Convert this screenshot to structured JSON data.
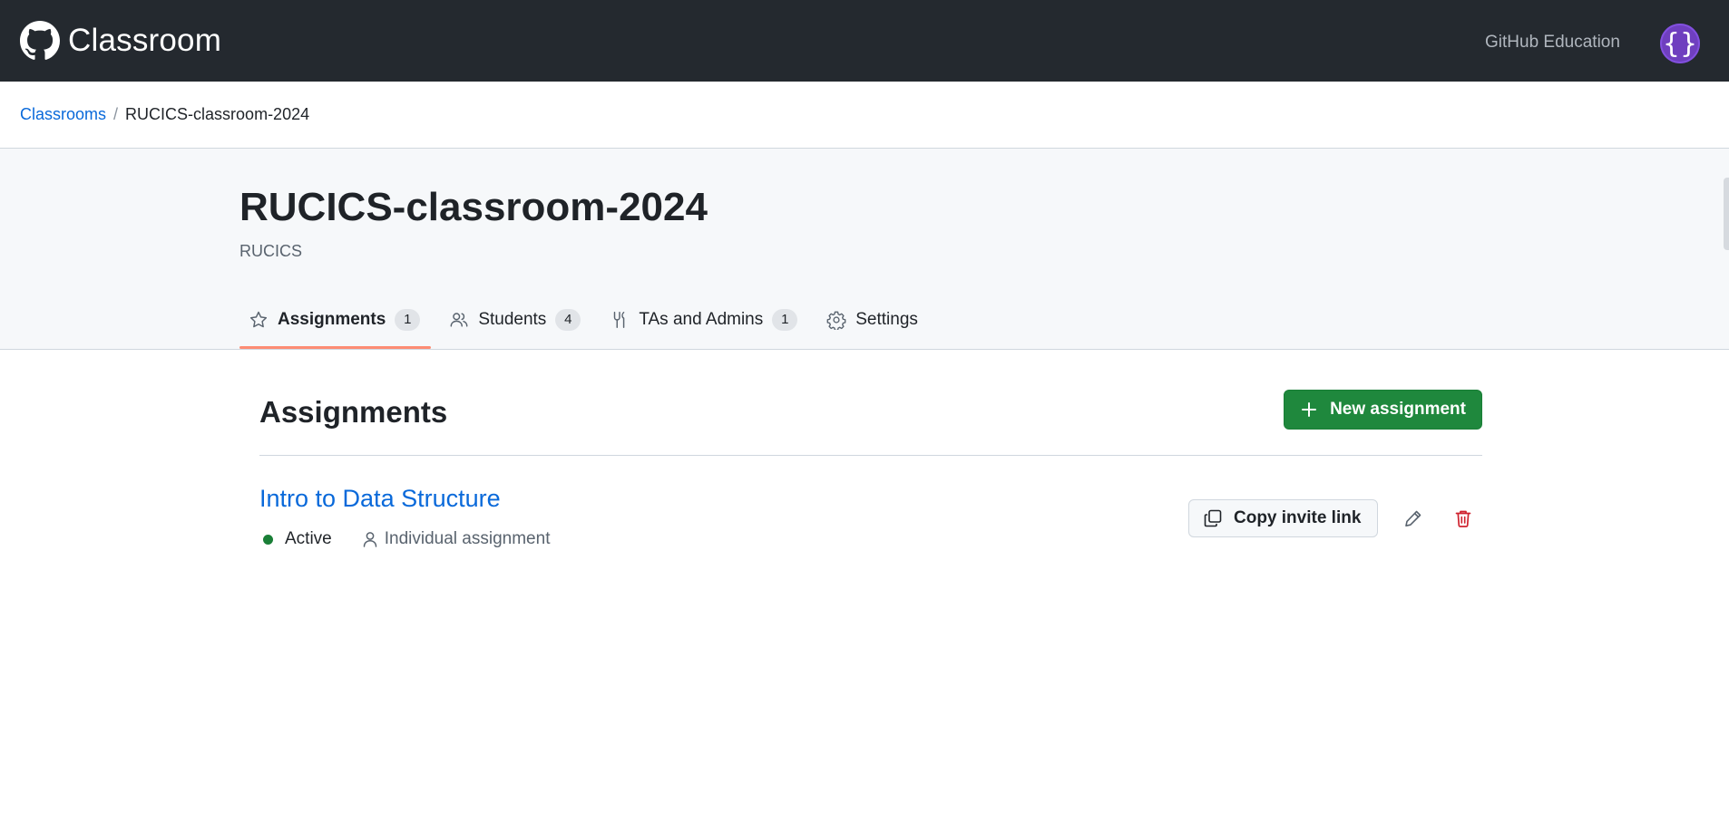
{
  "app": {
    "brand": "Classroom",
    "github_education": "GitHub Education",
    "avatar_text": "{}"
  },
  "breadcrumb": {
    "root": "Classrooms",
    "separator": "/",
    "current": "RUCICS-classroom-2024"
  },
  "classroom": {
    "title": "RUCICS-classroom-2024",
    "organization": "RUCICS"
  },
  "tabs": [
    {
      "label": "Assignments",
      "count": "1",
      "icon": "star-icon",
      "active": true
    },
    {
      "label": "Students",
      "count": "4",
      "icon": "people-icon",
      "active": false
    },
    {
      "label": "TAs and Admins",
      "count": "1",
      "icon": "tools-icon",
      "active": false
    },
    {
      "label": "Settings",
      "icon": "gear-icon",
      "active": false
    }
  ],
  "assignments_section": {
    "title": "Assignments",
    "new_button": "New assignment"
  },
  "assignments": [
    {
      "title": "Intro to Data Structure",
      "status": "Active",
      "type": "Individual assignment",
      "copy_button": "Copy invite link"
    }
  ],
  "colors": {
    "topbar": "#24292f",
    "link": "#0969da",
    "primary_button": "#1f883d",
    "active_tab_underline": "#fd8c73",
    "status_active": "#1a7f37",
    "danger": "#cf222e",
    "avatar": "#6f3fbf"
  }
}
